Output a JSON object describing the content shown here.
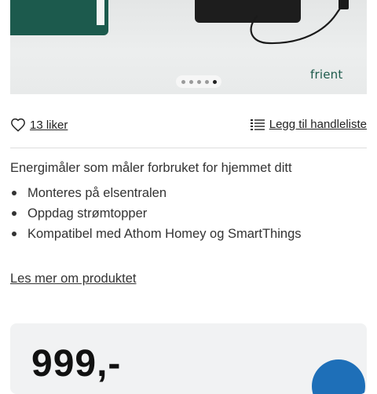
{
  "product": {
    "brand_logo": "frient",
    "gallery": {
      "slides": 5,
      "active_index": 4
    },
    "icon_names": {
      "like": "heart-icon",
      "list": "list-icon",
      "cart": "cart-icon"
    },
    "likes_label": "13 liker",
    "shopping_list_label": "Legg til handleliste",
    "description": "Energimåler som måler forbruket for hjemmet ditt",
    "features": [
      "Monteres på elsentralen",
      "Oppdag strømtopper",
      "Kompatibel med Athom Homey og SmartThings"
    ],
    "read_more_label": "Les mer om produktet",
    "price": "999,-"
  },
  "colors": {
    "brand_green": "#1c5a4d",
    "cart_button_blue": "#1e6fb8",
    "price_panel_bg": "#f1f2f3"
  }
}
